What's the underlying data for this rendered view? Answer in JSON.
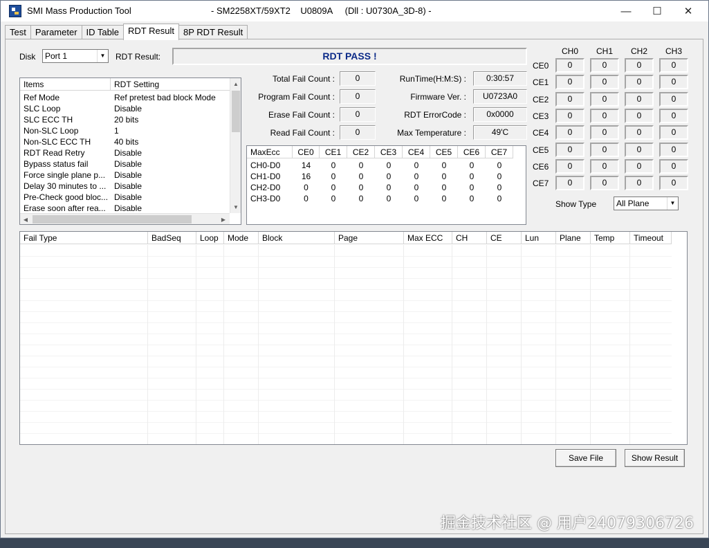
{
  "window": {
    "title": "SMI Mass Production Tool",
    "subtitle": "- SM2258XT/59XT2    U0809A     (Dll : U0730A_3D-8) -",
    "minimize": "—",
    "maximize": "☐",
    "close": "✕"
  },
  "tabs": [
    "Test",
    "Parameter",
    "ID Table",
    "RDT Result",
    "8P RDT Result"
  ],
  "active_tab": "RDT Result",
  "disk": {
    "label": "Disk",
    "value": "Port 1"
  },
  "rdt_result": {
    "label": "RDT Result:",
    "value": "RDT PASS !"
  },
  "settings": {
    "headers": [
      "Items",
      "RDT Setting"
    ],
    "rows": [
      [
        "Ref Mode",
        "Ref pretest bad block Mode"
      ],
      [
        "SLC Loop",
        "Disable"
      ],
      [
        "SLC ECC TH",
        "20 bits"
      ],
      [
        "Non-SLC Loop",
        "1"
      ],
      [
        "Non-SLC ECC TH",
        "40 bits"
      ],
      [
        "RDT Read Retry",
        "Disable"
      ],
      [
        "Bypass status fail",
        "Disable"
      ],
      [
        "Force single plane p...",
        "Disable"
      ],
      [
        "Delay 30 minutes to ...",
        "Disable"
      ],
      [
        "Pre-Check good bloc...",
        "Disable"
      ],
      [
        "Erase soon after rea...",
        "Disable"
      ]
    ]
  },
  "counts": [
    {
      "label": "Total Fail Count :",
      "value": "0"
    },
    {
      "label": "Program Fail Count :",
      "value": "0"
    },
    {
      "label": "Erase Fail Count :",
      "value": "0"
    },
    {
      "label": "Read Fail Count :",
      "value": "0"
    }
  ],
  "info": [
    {
      "label": "RunTime(H:M:S) :",
      "value": "0:30:57"
    },
    {
      "label": "Firmware Ver. :",
      "value": "U0723A0"
    },
    {
      "label": "RDT ErrorCode :",
      "value": "0x0000"
    },
    {
      "label": "Max Temperature :",
      "value": "49'C"
    }
  ],
  "maxecc": {
    "headers": [
      "MaxEcc",
      "CE0",
      "CE1",
      "CE2",
      "CE3",
      "CE4",
      "CE5",
      "CE6",
      "CE7"
    ],
    "rows": [
      [
        "CH0-D0",
        "14",
        "0",
        "0",
        "0",
        "0",
        "0",
        "0",
        "0"
      ],
      [
        "CH1-D0",
        "16",
        "0",
        "0",
        "0",
        "0",
        "0",
        "0",
        "0"
      ],
      [
        "CH2-D0",
        "0",
        "0",
        "0",
        "0",
        "0",
        "0",
        "0",
        "0"
      ],
      [
        "CH3-D0",
        "0",
        "0",
        "0",
        "0",
        "0",
        "0",
        "0",
        "0"
      ]
    ]
  },
  "ce_grid": {
    "ch_labels": [
      "CH0",
      "CH1",
      "CH2",
      "CH3"
    ],
    "ce_labels": [
      "CE0",
      "CE1",
      "CE2",
      "CE3",
      "CE4",
      "CE5",
      "CE6",
      "CE7"
    ],
    "values": [
      [
        "0",
        "0",
        "0",
        "0"
      ],
      [
        "0",
        "0",
        "0",
        "0"
      ],
      [
        "0",
        "0",
        "0",
        "0"
      ],
      [
        "0",
        "0",
        "0",
        "0"
      ],
      [
        "0",
        "0",
        "0",
        "0"
      ],
      [
        "0",
        "0",
        "0",
        "0"
      ],
      [
        "0",
        "0",
        "0",
        "0"
      ],
      [
        "0",
        "0",
        "0",
        "0"
      ]
    ]
  },
  "show_type": {
    "label": "Show Type",
    "value": "All Plane"
  },
  "fail_table": {
    "headers": [
      "Fail Type",
      "BadSeq",
      "Loop",
      "Mode",
      "Block",
      "Page",
      "Max ECC",
      "CH",
      "CE",
      "Lun",
      "Plane",
      "Temp",
      "Timeout"
    ]
  },
  "buttons": {
    "save_file": "Save File",
    "show_result": "Show Result"
  },
  "watermark": "掘金技术社区 @ 用户24079306726"
}
